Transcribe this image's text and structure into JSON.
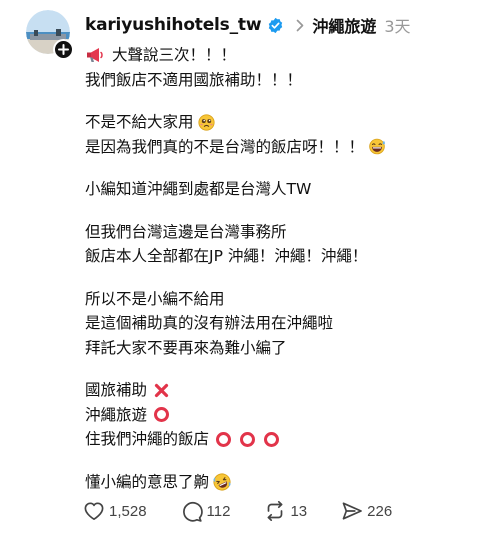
{
  "post": {
    "username": "kariyushihotels_tw",
    "topic": "沖繩旅遊",
    "time": "3天",
    "lines": [
      [
        "大聲說三次！！！",
        "我們飯店不適用國旅補助！！！"
      ],
      [
        "不是不給大家用",
        "是因為我們真的不是台灣的飯店呀！！！"
      ],
      [
        "小編知道沖繩到處都是台灣人TW"
      ],
      [
        "但我們台灣這邊是台灣事務所",
        "飯店本人全部都在JP 沖繩！沖繩！沖繩！"
      ],
      [
        "所以不是小編不給用",
        "是這個補助真的沒有辦法用在沖繩啦",
        "拜託大家不要再來為難小編了"
      ],
      [
        "國旅補助",
        "沖繩旅遊",
        "住我們沖繩的飯店"
      ],
      [
        "懂小編的意思了齁"
      ]
    ]
  },
  "actions": {
    "likes": "1,528",
    "comments": "112",
    "reposts": "13",
    "shares": "226"
  },
  "icons": {
    "megaphone": "megaphone-icon",
    "pleading": "pleading-face-icon",
    "laugh": "grinning-sweat-icon",
    "cross": "cross-mark-icon",
    "circle": "hollow-red-circle-icon",
    "rofl": "rolling-laughing-icon"
  },
  "colors": {
    "verified": "#1d9bf0",
    "mark_red": "#e2344a",
    "muted": "#999999"
  }
}
